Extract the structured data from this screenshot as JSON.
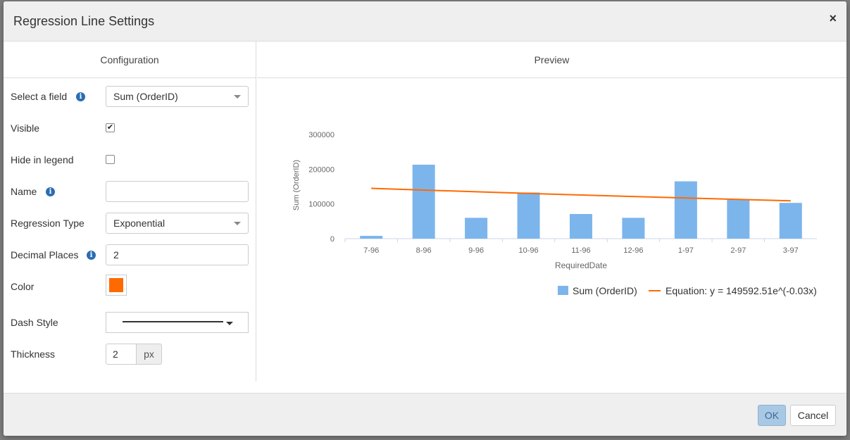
{
  "dialog": {
    "title": "Regression Line Settings",
    "close_symbol": "×"
  },
  "config": {
    "header": "Configuration",
    "field": {
      "label": "Select a field",
      "value": "Sum (OrderID)"
    },
    "visible": {
      "label": "Visible",
      "checked": true
    },
    "hide_legend": {
      "label": "Hide in legend",
      "checked": false
    },
    "name": {
      "label": "Name",
      "value": ""
    },
    "regression_type": {
      "label": "Regression Type",
      "value": "Exponential"
    },
    "decimal_places": {
      "label": "Decimal Places",
      "value": "2"
    },
    "color": {
      "label": "Color",
      "value": "#ff6a00"
    },
    "dash_style": {
      "label": "Dash Style",
      "value": "solid"
    },
    "thickness": {
      "label": "Thickness",
      "value": "2",
      "unit": "px"
    }
  },
  "preview": {
    "header": "Preview"
  },
  "chart_data": {
    "type": "bar",
    "categories": [
      "7-96",
      "8-96",
      "9-96",
      "10-96",
      "11-96",
      "12-96",
      "1-97",
      "2-97",
      "3-97"
    ],
    "series": [
      {
        "name": "Sum (OrderID)",
        "values": [
          8000,
          213000,
          60000,
          133000,
          71000,
          60000,
          165000,
          112000,
          103000
        ],
        "color": "#7cb5ec"
      }
    ],
    "trendline": {
      "name": "Equation: y = 149592.51e^(-0.03x)",
      "start": 145000,
      "end": 109000,
      "color": "#ff6a00"
    },
    "title": "",
    "xlabel": "RequiredDate",
    "ylabel": "Sum (OrderID)",
    "ylim": [
      0,
      300000
    ],
    "yticks": [
      "0",
      "100000",
      "200000",
      "300000"
    ],
    "grid": false,
    "legend": "bottom"
  },
  "footer": {
    "ok_label": "OK",
    "cancel_label": "Cancel"
  }
}
